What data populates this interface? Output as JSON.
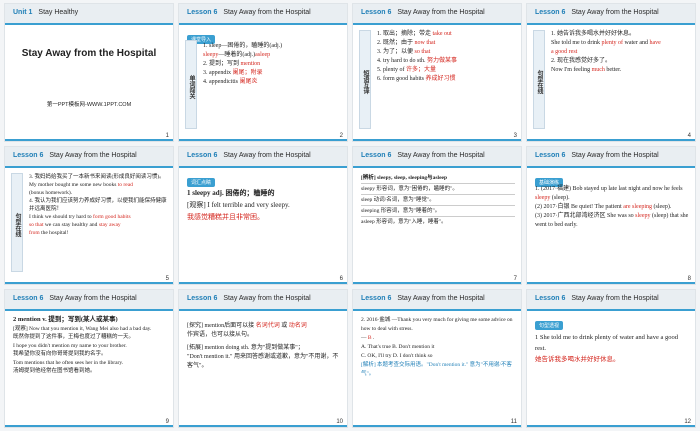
{
  "slides": [
    {
      "num": "1",
      "header_unit": "Unit 1",
      "header_title": "Stay Healthy",
      "title": "Stay Away from the Hospital",
      "link": "第一PPT模板网-WWW.1PPT.COM"
    },
    {
      "num": "2",
      "header_lesson": "Lesson 6",
      "header_title": "Stay Away from the Hospital",
      "tag": "课堂导入",
      "side": "单词闯关",
      "lines": [
        "1. sleep—困倦的，瞌睡的(adj.)",
        "sleepy",
        "—睡着的(adj.)",
        "asleep",
        "2. 提到；写到",
        "mention",
        "3. appendix",
        "阑尾；附录",
        "4. appendicitis",
        "阑尾炎"
      ]
    },
    {
      "num": "3",
      "header_lesson": "Lesson 6",
      "header_title": "Stay Away from the Hospital",
      "side": "短语互译",
      "lines": [
        "1. 取出；摘除；带走",
        "take out",
        "2. 既然；由于",
        "now that",
        "3. 为了；以便",
        "so that",
        "4. try hard to do sth.",
        "努力做某事",
        "5. plenty of",
        "许多；大量",
        "6. form good habits",
        "养成好习惯"
      ]
    },
    {
      "num": "4",
      "header_lesson": "Lesson 6",
      "header_title": "Stay Away from the Hospital",
      "side": "句型在线",
      "lines": [
        "1. 她告诉我多喝水并好好休息。",
        "She told me to drink",
        "plenty",
        "of",
        "water and",
        "have",
        "a",
        "good",
        "rest",
        "2. 现在我感觉好多了。",
        "Now I'm feeling",
        "much",
        "better."
      ]
    },
    {
      "num": "5",
      "header_lesson": "Lesson 6",
      "header_title": "Stay Away from the Hospital",
      "side": "句型在线",
      "lines": [
        "3. 我妈妈给我买了一本新书来阅读(形成良好阅读习惯)。",
        "My mother bought me some new books",
        "to",
        "read",
        "(bonus homework).",
        "4. 我认为我们应该努力养成好习惯，以便我们能保持健康并远离医院！",
        "I think we should try hard to",
        "form",
        "good",
        "habits",
        "so",
        "that",
        "we can stay healthy and",
        "stay",
        "away",
        "from",
        "the hospital!"
      ]
    },
    {
      "num": "6",
      "header_lesson": "Lesson 6",
      "header_title": "Stay Away from the Hospital",
      "tag": "词汇点睛",
      "lines": [
        "1 sleepy adj. 困倦的；瞌睡的",
        "[观察] I felt terrible and very sleepy.",
        "我感觉糟糕并且非常困。"
      ]
    },
    {
      "num": "7",
      "header_lesson": "Lesson 6",
      "header_title": "Stay Away from the Hospital",
      "lines": [
        "[辨析] sleepy, sleep, sleeping与asleep",
        "sleepy 形容词，意为\"困倦的，瞌睡的\"。",
        "sleep 动词/名词，意为\"睡觉\"。",
        "sleeping 形容词，意为\"睡着的\"。",
        "asleep 形容词，意为\"入睡，睡着\"。"
      ]
    },
    {
      "num": "8",
      "header_lesson": "Lesson 6",
      "header_title": "Stay Away from the Hospital",
      "tag": "基础演练",
      "lines": [
        "1. (2017·福建) Bob stayed up late last night and now he feels",
        "sleepy",
        "(sleep).",
        "(2) 2017·白银 Be quiet! The patient",
        "are sleeping",
        "(sleep).",
        "(3) 2017·广西北部湾经济区 She was so",
        "sleepy",
        "(sleep) that she went to bed early."
      ]
    },
    {
      "num": "9",
      "header_lesson": "Lesson 6",
      "header_title": "Stay Away from the Hospital",
      "lines": [
        "2 mention v. 提到；写到(某人或某事)",
        "[观察] Now that you mention it, Wang Mei also had a bad day.",
        "既然你提到了这件事，王梅也度过了糟糕的一天。",
        "I hope you didn't mention my name to your brother.",
        "我希望你没有向你哥哥提到我的名字。",
        "Tom mentions that he often sees her in the library.",
        "汤姆提到他经常在图书馆看到她。"
      ]
    },
    {
      "num": "10",
      "header_lesson": "Lesson 6",
      "header_title": "Stay Away from the Hospital",
      "lines": [
        "[探究] mention后面可以接",
        "名词",
        "代词",
        "或",
        "动名词",
        "作宾语，也可以接从句。",
        "[拓展] mention doing sth. 意为\"提到做某事\"；",
        "\"Don't mention it.\" 用来回答感谢或道歉，意为\"不用谢，不客气\"。"
      ]
    },
    {
      "num": "11",
      "header_lesson": "Lesson 6",
      "header_title": "Stay Away from the Hospital",
      "lines": [
        "2. 2016·盐城 —Thank you very much for giving me some advice on how to deal with stress.",
        "—",
        "B",
        ".",
        "A. That's true  B. Don't mention it",
        "C. OK, I'll try  D. I don't think so",
        "[解析] 本题考查交际用语。\"Don't mention it.\" 意为\"不用谢/不客气\"。"
      ]
    },
    {
      "num": "12",
      "header_lesson": "Lesson 6",
      "header_title": "Stay Away from the Hospital",
      "tag": "句型透视",
      "lines": [
        "1 She told me to drink plenty of water and have a good rest.",
        "她告诉我多喝水并好好休息。"
      ]
    }
  ]
}
